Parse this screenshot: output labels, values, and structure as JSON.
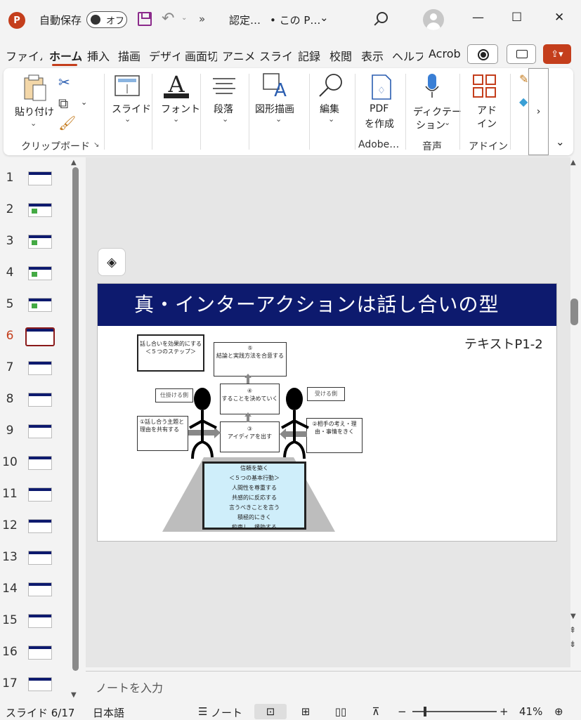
{
  "titlebar": {
    "app_icon": "P",
    "autosave_label": "自動保存",
    "autosave_state": "オフ",
    "more": "»",
    "doc_title": "認定…",
    "doc_location": "• この P…",
    "minimize": "—",
    "maximize": "☐",
    "close": "✕"
  },
  "tabs": [
    "ファイル",
    "ホーム",
    "挿入",
    "描画",
    "デザイン",
    "画面切",
    "アニメー",
    "スライド",
    "記録",
    "校閲",
    "表示",
    "ヘルプ",
    "Acrobat"
  ],
  "ribbon": {
    "paste_label": "貼り付け",
    "clipboard_group": "クリップボード",
    "slide_label": "スライド",
    "font_label": "フォント",
    "paragraph_label": "段落",
    "drawing_label": "図形描画",
    "edit_label": "編集",
    "pdf_label_1": "PDF",
    "pdf_label_2": "を作成",
    "adobe_group": "Adobe…",
    "dictate_label_1": "ディクテー",
    "dictate_label_2": "ション",
    "voice_group": "音声",
    "addin_label_1": "アド",
    "addin_label_2": "イン",
    "addin_group": "アドイン",
    "overflow": "›",
    "collapse": "⌄"
  },
  "thumbnails": {
    "numbers": [
      "1",
      "2",
      "3",
      "4",
      "5",
      "6",
      "7",
      "8",
      "9",
      "10",
      "11",
      "12",
      "13",
      "14",
      "15",
      "16",
      "17"
    ],
    "active": "6"
  },
  "slide": {
    "title": "真・インターアクションは話し合いの型",
    "reference": "テキストP1-2",
    "steps_box": "話し合いを効果的にする\n＜５つのステップ＞",
    "step5": "⑤\n結論と実践方法を合意する",
    "step4": "④\nすることを決めていく",
    "step3": "③\nアイディアを出す",
    "step1": "①話し合う主題と\n理由を共有する",
    "step2": "②相手の考え・理\n由・事情をきく",
    "left_tag": "仕掛ける側",
    "right_tag": "受ける側",
    "board_lines": [
      "信頼を築く",
      "＜５つの基本行動＞",
      "人間性を尊重する",
      "共感的に反応する",
      "言うべきことを言う",
      "積極的にきく",
      "約束し、援助する"
    ]
  },
  "notes_placeholder": "ノートを入力",
  "statusbar": {
    "slide_info": "スライド 6/17",
    "language": "日本語",
    "notes_label": "ノート",
    "zoom": "41%",
    "zoom_minus": "−",
    "zoom_plus": "+"
  }
}
